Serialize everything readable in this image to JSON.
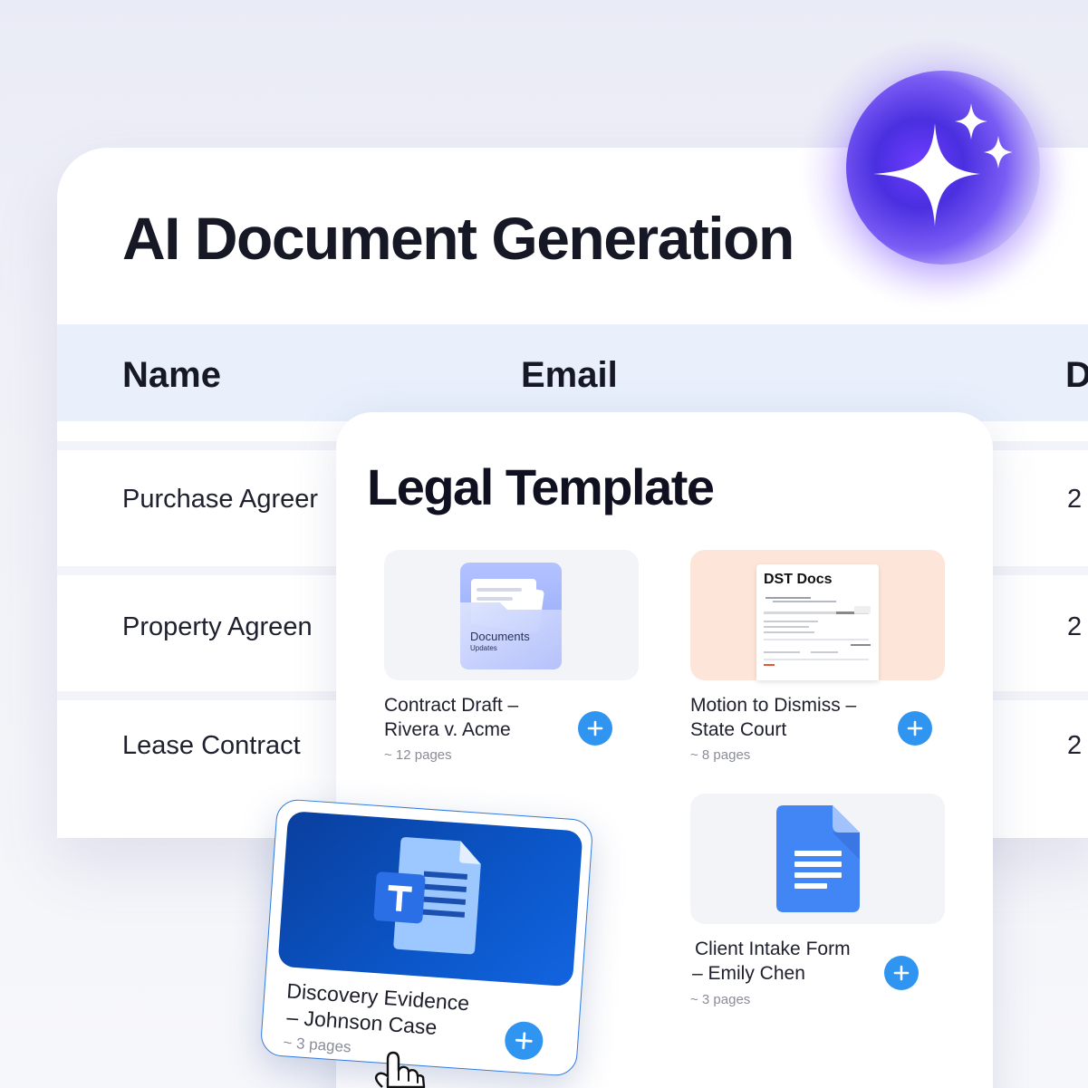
{
  "header": {
    "title": "AI Document Generation"
  },
  "table": {
    "columns": [
      "Name",
      "Email",
      "D"
    ],
    "rows": [
      {
        "name": "Purchase Agreer",
        "date": "2"
      },
      {
        "name": "Property Agreen",
        "date": "2"
      },
      {
        "name": "Lease Contract",
        "date": "2"
      }
    ]
  },
  "templates": {
    "title": "Legal Template",
    "items": [
      {
        "line1": "Contract Draft –",
        "line2": "Rivera v. Acme",
        "meta": "~ 12 pages",
        "thumb": "Documents",
        "thumb_sub": "Updates"
      },
      {
        "line1": "Motion to Dismiss –",
        "line2": "State Court",
        "meta": "~ 8 pages",
        "thumb": "DST Docs"
      },
      {
        "line1": "Client Intake Form",
        "line2": "– Emily Chen",
        "meta": "~ 3 pages"
      }
    ],
    "floating": {
      "line1": "Discovery Evidence",
      "line2": "– Johnson Case",
      "meta": "~ 3 pages"
    }
  },
  "colors": {
    "accent": "#2f95f0",
    "header_row": "#e9f0fc",
    "orb": "#6d3dff",
    "gdocs_blue": "#4285f4",
    "teams_blue": "#0b56c8",
    "motion_tile_bg": "#fde6d9",
    "docs_tile_bg": "#f3f4f8"
  },
  "icons": [
    "sparkle-icon",
    "plus-icon",
    "folder-icon",
    "google-doc-icon",
    "teams-doc-icon",
    "hand-pointer-icon"
  ]
}
